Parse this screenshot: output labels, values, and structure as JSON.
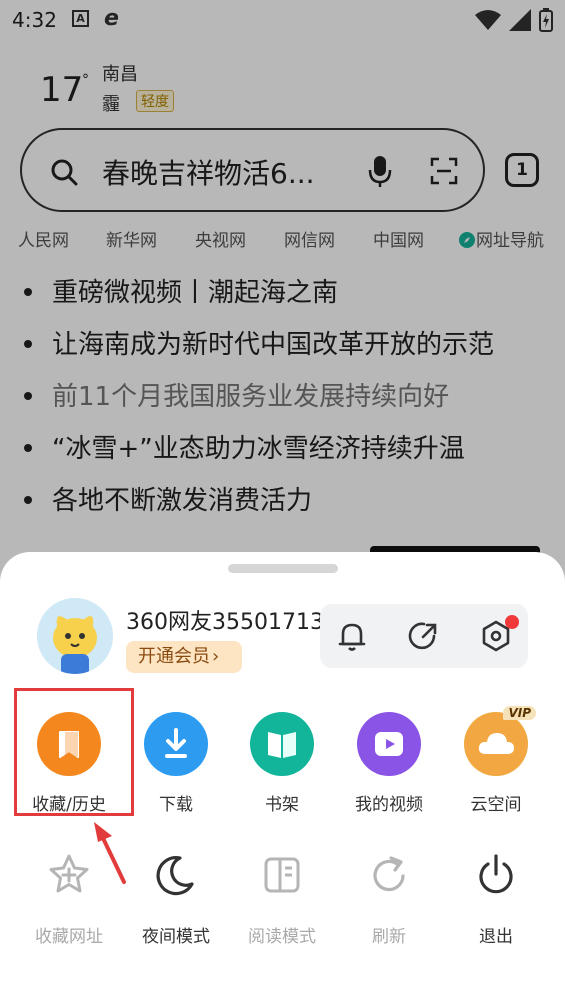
{
  "status_bar": {
    "time": "4:32",
    "a_icon": "A"
  },
  "weather": {
    "temperature": "17",
    "unit": "°",
    "city": "南昌",
    "condition": "霾",
    "air_quality": "轻度"
  },
  "search": {
    "query": "春晚吉祥物活6...",
    "tab_count": "1"
  },
  "quick_links": [
    "人民网",
    "新华网",
    "央视网",
    "网信网",
    "中国网",
    "网址导航"
  ],
  "news": [
    {
      "title": "重磅微视频丨潮起海之南",
      "read": false
    },
    {
      "title": "让海南成为新时代中国改革开放的示范",
      "read": false
    },
    {
      "title": "前11个月我国服务业发展持续向好",
      "read": true
    },
    {
      "title": "“冰雪+”业态助力冰雪经济持续升温",
      "read": false
    },
    {
      "title": "各地不断激发消费活力",
      "read": false
    }
  ],
  "sheet": {
    "username": "360网友35501713",
    "vip_button": "开通会员",
    "vip_arrow": "›",
    "row1": [
      {
        "label": "收藏/历史",
        "icon": "bookmark-icon",
        "color": "#f5871f"
      },
      {
        "label": "下载",
        "icon": "download-icon",
        "color": "#2d9bf0"
      },
      {
        "label": "书架",
        "icon": "book-icon",
        "color": "#12b59a"
      },
      {
        "label": "我的视频",
        "icon": "video-icon",
        "color": "#8a55e6"
      },
      {
        "label": "云空间",
        "icon": "cloud-icon",
        "color": "#f2a742",
        "tag": "VIP"
      }
    ],
    "row2": [
      {
        "label": "收藏网址",
        "icon": "star-icon",
        "disabled": true
      },
      {
        "label": "夜间模式",
        "icon": "moon-icon",
        "disabled": false
      },
      {
        "label": "阅读模式",
        "icon": "reader-icon",
        "disabled": true
      },
      {
        "label": "刷新",
        "icon": "refresh-icon",
        "disabled": true
      },
      {
        "label": "退出",
        "icon": "power-icon",
        "disabled": false
      }
    ]
  }
}
